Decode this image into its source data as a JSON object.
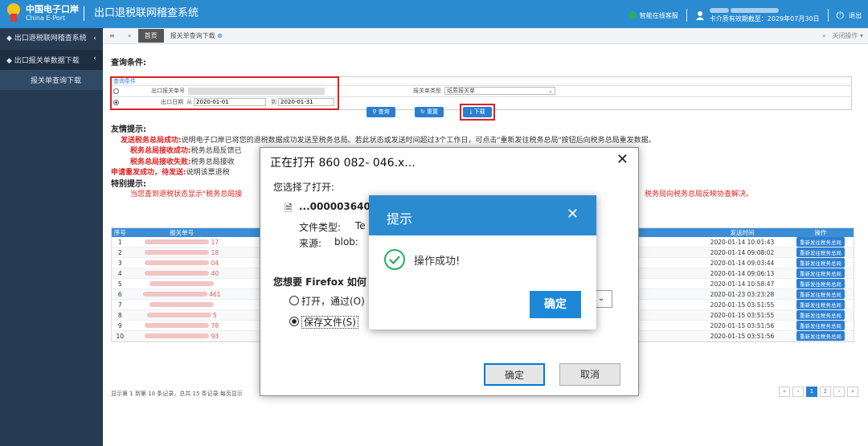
{
  "header": {
    "logo_cn": "中国电子口岸",
    "logo_en": "China E-Port",
    "system_title": "出口退税联网稽查系统",
    "online_service": "智能在线客服",
    "validity": "卡介质有效期截至：2029年07月30日",
    "logout": "退出"
  },
  "sidebar": {
    "root": "出口退税联网稽查系统",
    "group": "出口报关单数据下载",
    "leaf": "报关单查询下载"
  },
  "tabs": {
    "home": "首页",
    "active": "报关单查询下载",
    "close_ops": "关闭操作"
  },
  "query": {
    "title": "查询条件:",
    "legend": "查询条件",
    "decl_no_label": "出口报关单号",
    "decl_type_label": "报关单类型",
    "decl_type_value": "纸质报关单",
    "date_label": "出口日期",
    "from": "从",
    "to": "到",
    "date_from": "2020-01-01",
    "date_to": "2020-01-31",
    "btn_query": "查询",
    "btn_reset": "重置",
    "btn_download": "下载"
  },
  "tips": {
    "friendly_title": "友情提示:",
    "lines": [
      {
        "label": "发送税务总局成功:",
        "text": "说明电子口岸已将您的退税数据成功发送至税务总局。若此状态或发送时间超过3个工作日，可点击\"重新发往税务总局\"按钮后向税务总局重发数据。"
      },
      {
        "label": "税务总局接收成功:",
        "text": "税务总局反馈已"
      },
      {
        "label": "税务总局接收失败:",
        "text": "税务总局接收"
      },
      {
        "label": "申请重发成功，待发送:",
        "text": "说明该票退税"
      }
    ],
    "special_title": "特别提示:",
    "special_text": "当您查到退税状态显示\"税务总局接",
    "special_tail": "税务局向税务总局反映协查解决。"
  },
  "table": {
    "headers": [
      "序号",
      "报关单号",
      "发送时间",
      "操作"
    ],
    "rows": [
      {
        "no": "1",
        "id": "17",
        "time": "2020-01-14 10:01:43"
      },
      {
        "no": "2",
        "id": "18",
        "time": "2020-01-14 09:08:02"
      },
      {
        "no": "3",
        "id": "04",
        "time": "2020-01-14 09:03:44"
      },
      {
        "no": "4",
        "id": "40",
        "time": "2020-01-14 09:06:13"
      },
      {
        "no": "5",
        "id": "",
        "time": "2020-01-14 10:58:47"
      },
      {
        "no": "6",
        "id": "461",
        "time": "2020-01-23 03:23:28"
      },
      {
        "no": "7",
        "id": "",
        "time": "2020-01-15 03:51:55"
      },
      {
        "no": "8",
        "id": "5",
        "time": "2020-01-15 03:51:55"
      },
      {
        "no": "9",
        "id": "78",
        "time": "2020-01-15 03:51:56"
      },
      {
        "no": "10",
        "id": "93",
        "time": "2020-01-15 03:51:56"
      }
    ],
    "resend_label": "重新发往税务总局",
    "footer": "显示第 1 到第 10 条记录，总共 15 条记录 每页显示",
    "pages": [
      "«",
      "‹",
      "1",
      "2",
      "›",
      "»"
    ]
  },
  "firefox_dialog": {
    "title": "正在打开 860            082-               046.x...",
    "chosen": "您选择了打开:",
    "file_name": "...000003640",
    "file_ext": "xml",
    "file_type_label": "文件类型:",
    "file_type_value": "Te",
    "source_label": "来源:",
    "source_value": "blob:",
    "question": "您想要 Firefox 如何",
    "open_with": "打开，通过(O)",
    "save_file": "保存文件(S)",
    "ok": "确定",
    "cancel": "取消"
  },
  "message": {
    "title": "提示",
    "text": "操作成功!",
    "ok": "确定"
  }
}
